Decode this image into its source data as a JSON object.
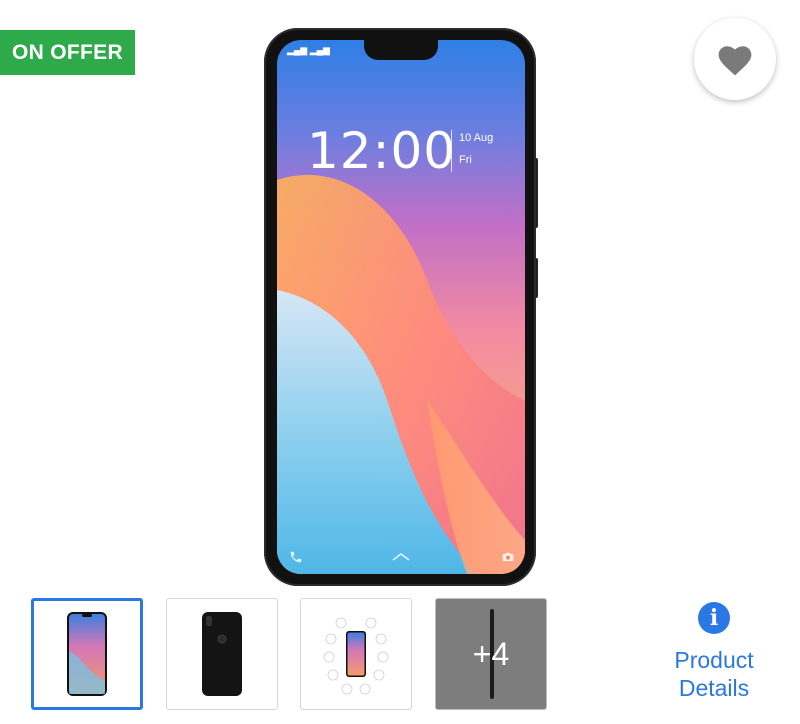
{
  "badge": {
    "label": "ON OFFER"
  },
  "wishlist": {
    "icon": "heart-icon"
  },
  "hero_phone": {
    "time": "12:00",
    "date": "10 Aug",
    "day": "Fri",
    "icons": [
      "phone-icon",
      "camera-icon",
      "chevron-up-icon",
      "signal-icon"
    ]
  },
  "thumbnails": [
    {
      "kind": "phone-front",
      "selected": true
    },
    {
      "kind": "phone-back",
      "selected": false
    },
    {
      "kind": "features",
      "selected": false
    },
    {
      "kind": "more",
      "label": "+4",
      "selected": false
    }
  ],
  "product_details": {
    "label_line1": "Product",
    "label_line2": "Details",
    "icon": "info-icon"
  },
  "colors": {
    "accent": "#2a78e4",
    "offer": "#2faa4a",
    "heart": "#7a7a7a"
  }
}
